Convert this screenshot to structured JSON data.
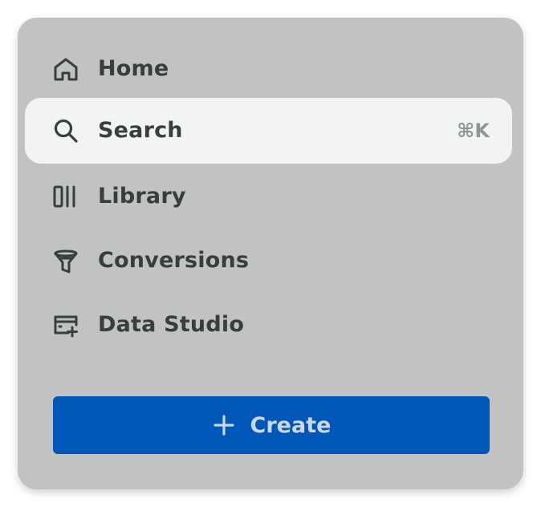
{
  "nav": {
    "items": [
      {
        "label": "Home",
        "icon": "home-icon",
        "active": false
      },
      {
        "label": "Search",
        "icon": "search-icon",
        "active": true,
        "shortcut": "⌘K"
      },
      {
        "label": "Library",
        "icon": "library-icon",
        "active": false
      },
      {
        "label": "Conversions",
        "icon": "funnel-icon",
        "active": false
      },
      {
        "label": "Data Studio",
        "icon": "data-studio-icon",
        "active": false
      }
    ]
  },
  "create": {
    "label": "Create",
    "icon": "plus-icon"
  },
  "colors": {
    "panel_bg": "#c1c2c2",
    "active_bg": "#f2f4f3",
    "text": "#3a3d3e",
    "shortcut_text": "#8f9595",
    "create_bg": "#0057b8",
    "create_text": "#c9d7ea"
  }
}
